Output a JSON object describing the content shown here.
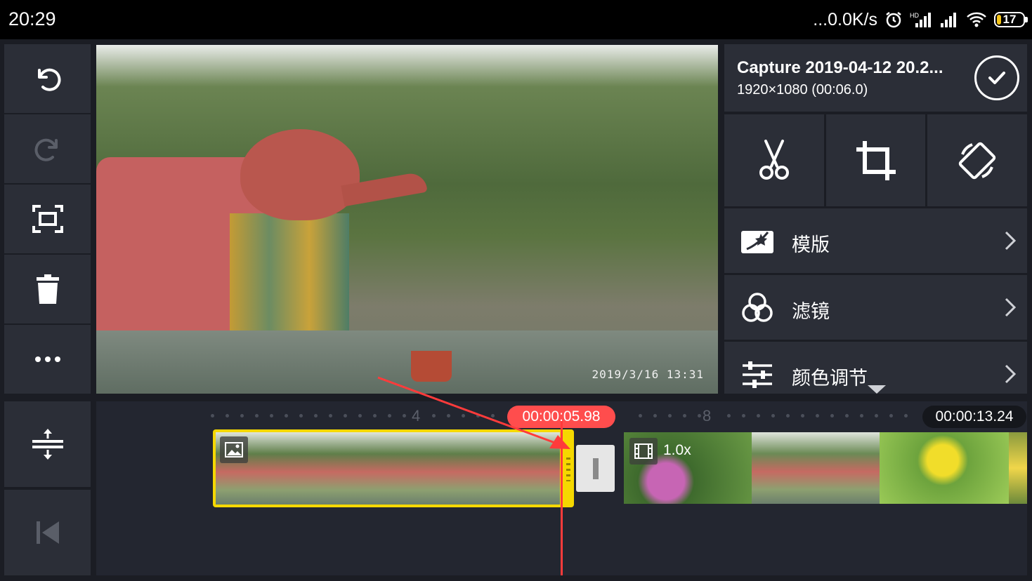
{
  "status_bar": {
    "time": "20:29",
    "network_speed": "...0.0K/s",
    "battery_level": "17",
    "icons": [
      "alarm-icon",
      "hd-signal-icon",
      "signal-icon",
      "wifi-icon",
      "battery-icon"
    ]
  },
  "left_toolbar": {
    "items": [
      {
        "name": "undo",
        "icon": "undo-icon",
        "enabled": true
      },
      {
        "name": "redo",
        "icon": "redo-icon",
        "enabled": false
      },
      {
        "name": "fullscreen",
        "icon": "fullscreen-icon",
        "enabled": true
      },
      {
        "name": "delete",
        "icon": "trash-icon",
        "enabled": true
      },
      {
        "name": "more",
        "icon": "more-icon",
        "enabled": true
      }
    ]
  },
  "preview": {
    "timestamp_overlay": "2019/3/16  13:31"
  },
  "clip_panel": {
    "title": "Capture 2019-04-12 20.2...",
    "resolution": "1920×1080 (00:06.0)",
    "tools": [
      {
        "name": "split",
        "icon": "scissors-icon"
      },
      {
        "name": "crop",
        "icon": "crop-icon"
      },
      {
        "name": "rotate",
        "icon": "rotate-icon"
      }
    ],
    "menu": [
      {
        "label": "模版",
        "icon": "template-icon"
      },
      {
        "label": "滤镜",
        "icon": "filter-icon"
      },
      {
        "label": "颜色调节",
        "icon": "sliders-icon"
      }
    ]
  },
  "timeline": {
    "ruler_labels": [
      "4",
      "8"
    ],
    "playhead_time": "00:00:05.98",
    "total_duration": "00:00:13.24",
    "clips": [
      {
        "type": "image",
        "icon": "image-icon",
        "selected": true
      },
      {
        "type": "video",
        "icon": "film-icon",
        "speed_label": "1.0x",
        "selected": false
      }
    ],
    "side_tools": [
      {
        "name": "layers",
        "icon": "layers-icon"
      },
      {
        "name": "jump-to-start",
        "icon": "skip-start-icon"
      }
    ]
  },
  "colors": {
    "accent_yellow": "#f5d800",
    "playhead_red": "#ff4d4d",
    "panel_bg": "#2b2e37",
    "background": "#1b1d24"
  }
}
